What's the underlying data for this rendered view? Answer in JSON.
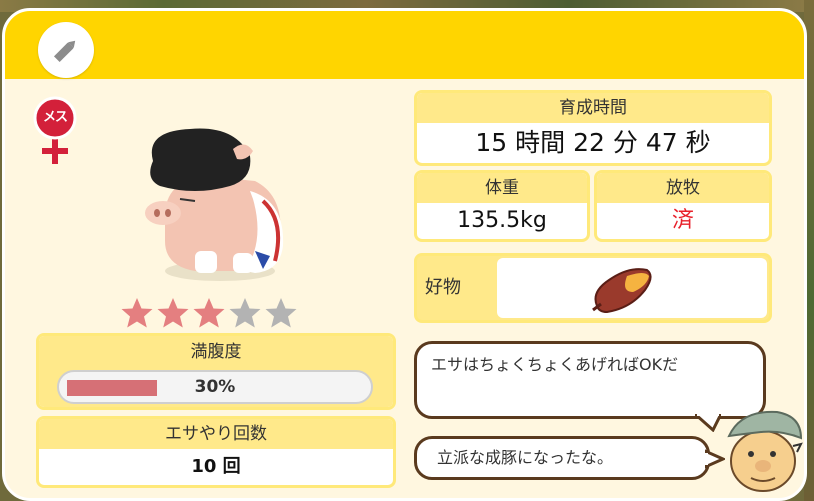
{
  "gender": {
    "label": "メス"
  },
  "stars": {
    "filled": 3,
    "total": 5,
    "filled_color": "#e47f80",
    "empty_color": "#b3b3b3"
  },
  "satiety": {
    "label": "満腹度",
    "value_text": "30%",
    "value": 30
  },
  "feed_count": {
    "label": "エサやり回数",
    "value": "10 回"
  },
  "raise_time": {
    "label": "育成時間",
    "value": "15 時間 22 分 47 秒"
  },
  "weight": {
    "label": "体重",
    "value": "135.5kg"
  },
  "grazing": {
    "label": "放牧",
    "value": "済"
  },
  "favorite": {
    "label": "好物",
    "item_icon": "sweet-potato-icon"
  },
  "speech": {
    "bubble_1": "エサはちょくちょくあげればOKだ",
    "bubble_2": "立派な成豚になったな。"
  },
  "colors": {
    "header": "#ffd500",
    "card_head": "#ffe98a",
    "accent_red": "#e8202a",
    "bubble_border": "#5a3a1e"
  }
}
